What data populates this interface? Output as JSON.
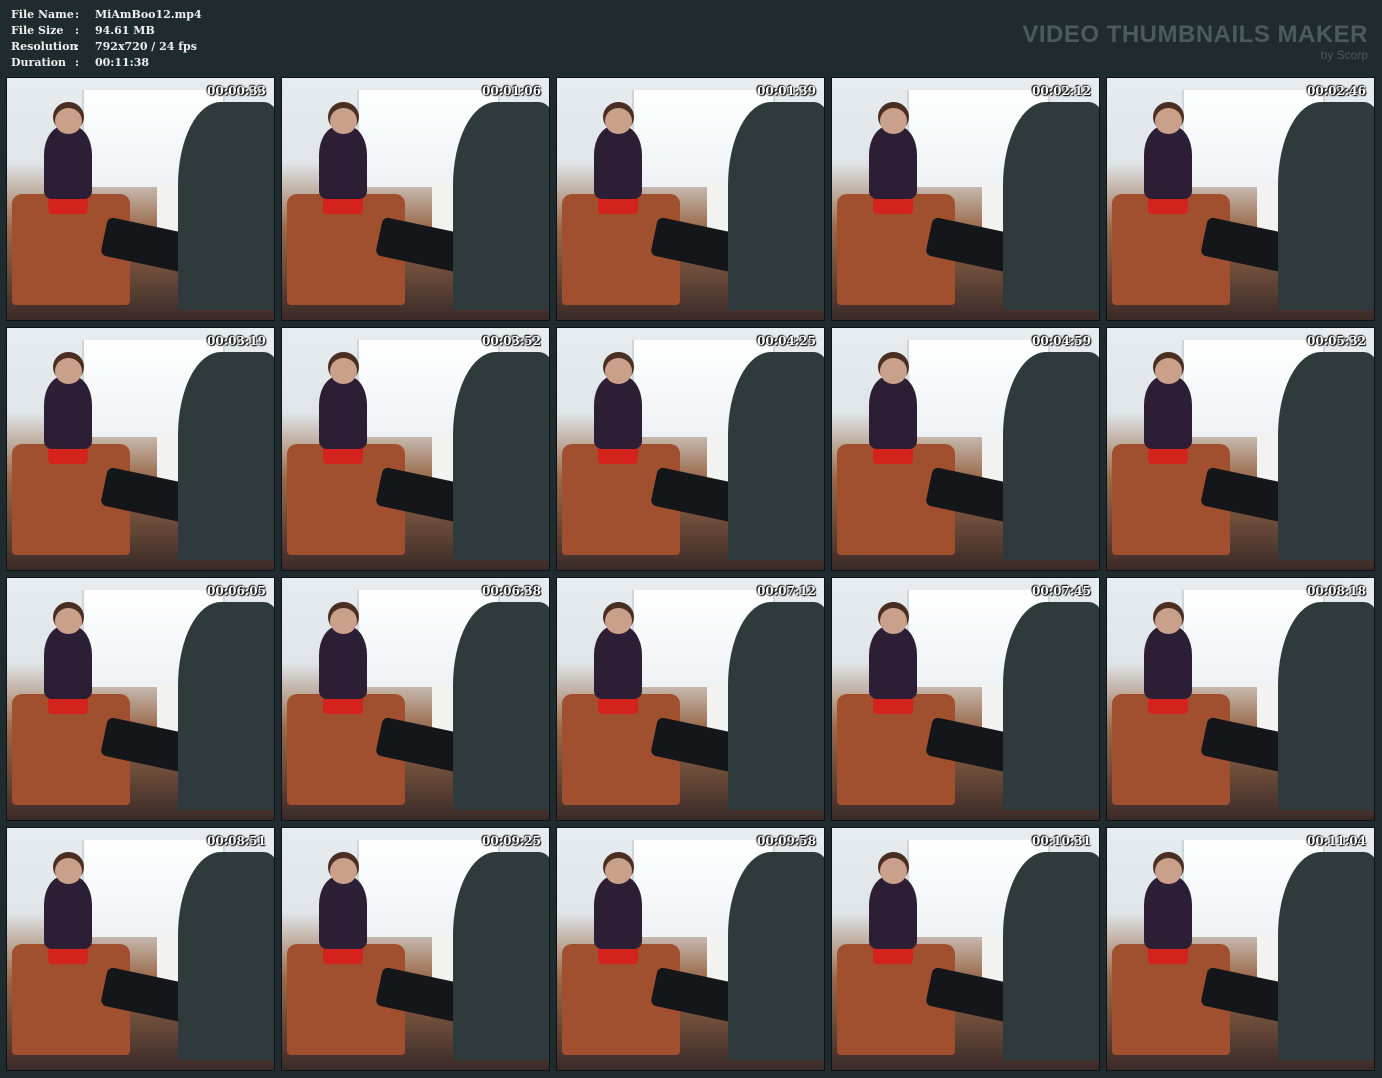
{
  "file_info": [
    {
      "label": "File Name",
      "value": "MiAmBoo12.mp4"
    },
    {
      "label": "File Size",
      "value": "94.61 MB"
    },
    {
      "label": "Resolution",
      "value": "792x720 / 24 fps"
    },
    {
      "label": "Duration",
      "value": "00:11:38"
    }
  ],
  "separator": ":",
  "brand": {
    "title": "VIDEO THUMBNAILS MAKER",
    "by": "by Scorp"
  },
  "thumbnails": [
    {
      "timestamp": "00:00:33"
    },
    {
      "timestamp": "00:01:06"
    },
    {
      "timestamp": "00:01:39"
    },
    {
      "timestamp": "00:02:12"
    },
    {
      "timestamp": "00:02:46"
    },
    {
      "timestamp": "00:03:19"
    },
    {
      "timestamp": "00:03:52"
    },
    {
      "timestamp": "00:04:25"
    },
    {
      "timestamp": "00:04:59"
    },
    {
      "timestamp": "00:05:32"
    },
    {
      "timestamp": "00:06:05"
    },
    {
      "timestamp": "00:06:38"
    },
    {
      "timestamp": "00:07:12"
    },
    {
      "timestamp": "00:07:45"
    },
    {
      "timestamp": "00:08:18"
    },
    {
      "timestamp": "00:08:51"
    },
    {
      "timestamp": "00:09:25"
    },
    {
      "timestamp": "00:09:58"
    },
    {
      "timestamp": "00:10:31"
    },
    {
      "timestamp": "00:11:04"
    }
  ]
}
